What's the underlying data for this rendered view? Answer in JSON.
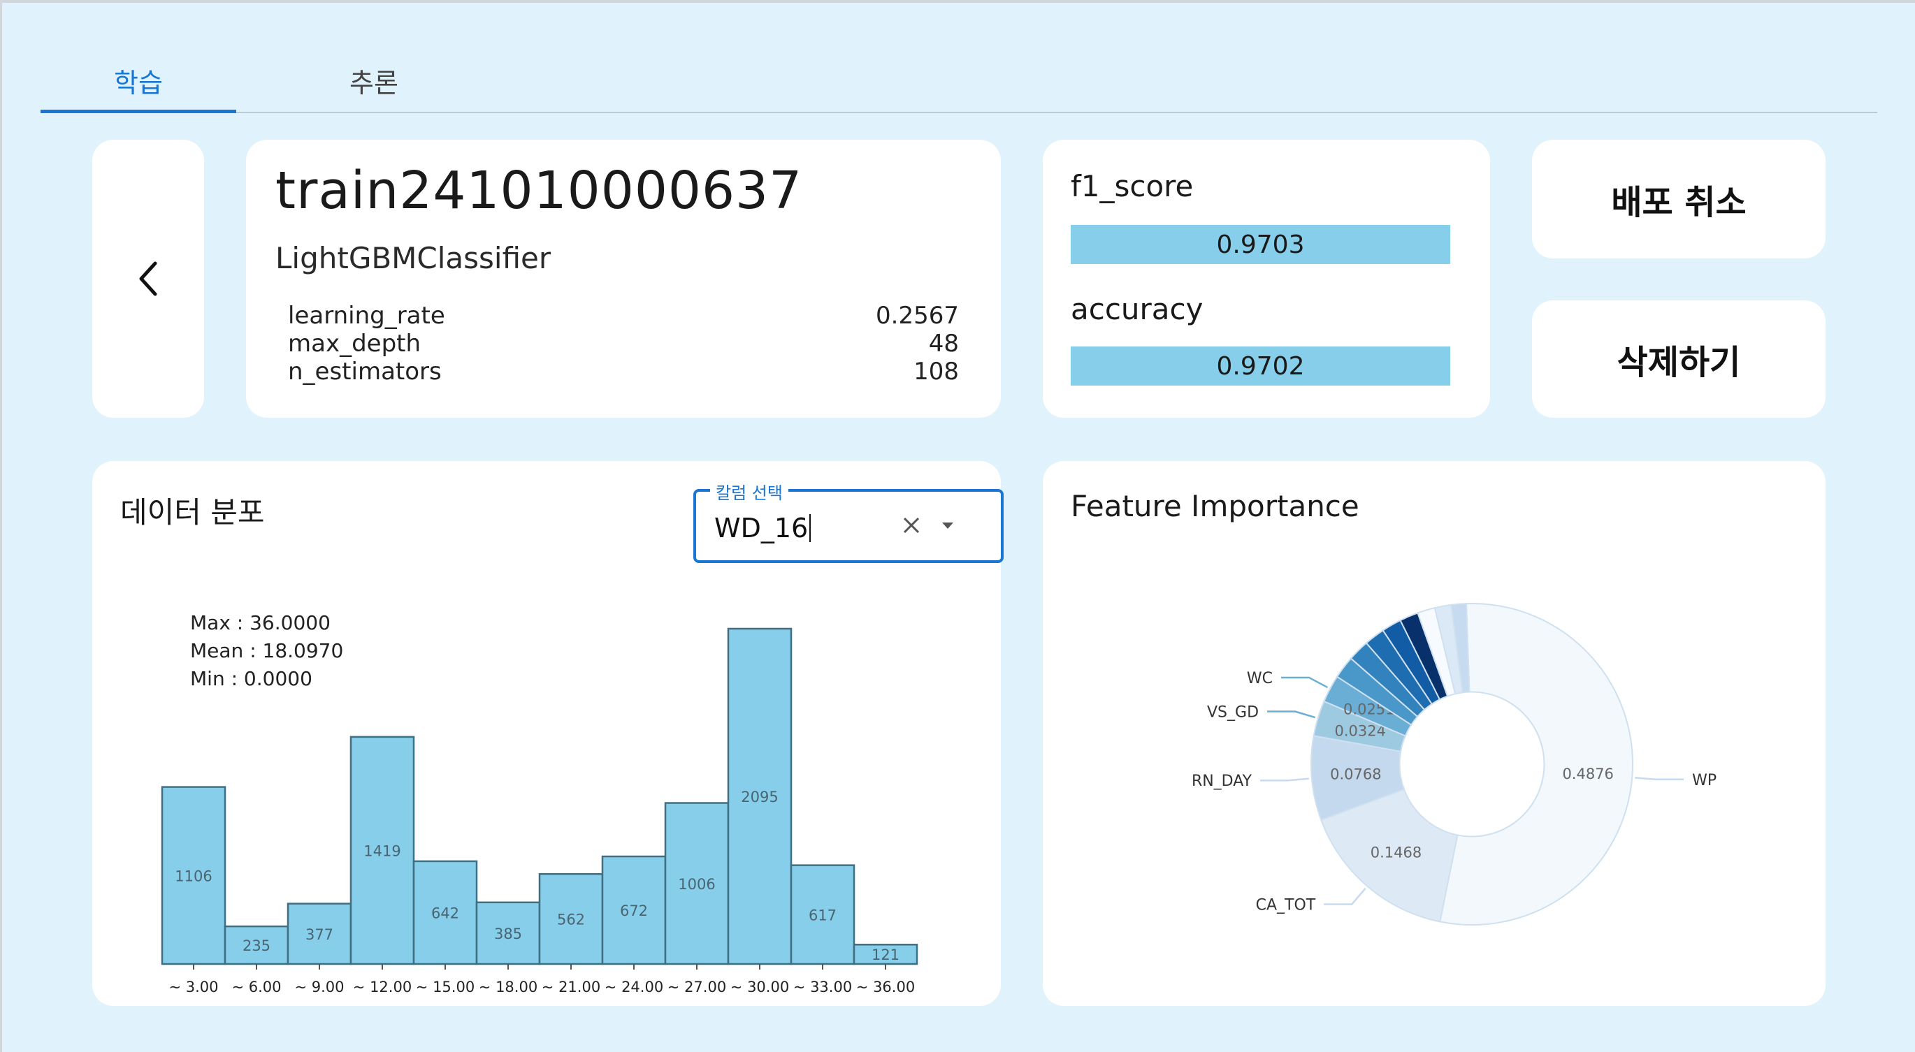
{
  "tabs": [
    {
      "label": "학습",
      "active": true
    },
    {
      "label": "추론",
      "active": false
    }
  ],
  "model": {
    "name": "train241010000637",
    "algorithm": "LightGBMClassifier",
    "params": [
      {
        "name": "learning_rate",
        "value": "0.2567"
      },
      {
        "name": "max_depth",
        "value": "48"
      },
      {
        "name": "n_estimators",
        "value": "108"
      }
    ]
  },
  "metrics": [
    {
      "label": "f1_score",
      "value": "0.9703"
    },
    {
      "label": "accuracy",
      "value": "0.9702"
    }
  ],
  "actions": {
    "cancel_deploy": "배포 취소",
    "delete": "삭제하기"
  },
  "distribution": {
    "title": "데이터 분포",
    "select_label": "칼럼 선택",
    "select_value": "WD_16",
    "stats": {
      "max": "Max : 36.0000",
      "mean": "Mean : 18.0970",
      "min": "Min : 0.0000"
    }
  },
  "chart_data": [
    {
      "type": "bar",
      "categories": [
        "~ 3.00",
        "~ 6.00",
        "~ 9.00",
        "~ 12.00",
        "~ 15.00",
        "~ 18.00",
        "~ 21.00",
        "~ 24.00",
        "~ 27.00",
        "~ 30.00",
        "~ 33.00",
        "~ 36.00"
      ],
      "values": [
        1106,
        235,
        377,
        1419,
        642,
        385,
        562,
        672,
        1006,
        2095,
        617,
        121
      ],
      "bar_color": "#87ceeb",
      "bar_stroke": "#3f6f82",
      "ylim": [
        0,
        2095
      ]
    },
    {
      "type": "pie",
      "title": "Feature Importance",
      "slices": [
        {
          "label": "WP",
          "value": 0.4876,
          "value_label": "0.4876",
          "color": "#f3f8fd"
        },
        {
          "label": "CA_TOT",
          "value": 0.1468,
          "value_label": "0.1468",
          "color": "#dde9f5"
        },
        {
          "label": "RN_DAY",
          "value": 0.0768,
          "value_label": "0.0768",
          "color": "#c4d9ee"
        },
        {
          "label": "VS_GD",
          "value": 0.0324,
          "value_label": "0.0324",
          "color": "#9ecae1"
        },
        {
          "label": "WC",
          "value": 0.0251,
          "value_label": "0.0251",
          "color": "#6aaed6"
        },
        {
          "label": "",
          "value": 0.0206,
          "value_label": "",
          "color": "#4a98c9"
        },
        {
          "label": "",
          "value": 0.0196,
          "value_label": "",
          "color": "#3182bd"
        },
        {
          "label": "",
          "value": 0.0188,
          "value_label": "",
          "color": "#1f6db1"
        },
        {
          "label": "",
          "value": 0.018,
          "value_label": "",
          "color": "#115ca5"
        },
        {
          "label": "",
          "value": 0.017,
          "value_label": "",
          "color": "#08306b"
        },
        {
          "label": "",
          "value": 0.016,
          "value_label": "",
          "color": "#f7fbff"
        },
        {
          "label": "",
          "value": 0.015,
          "value_label": "",
          "color": "#dbe9f6"
        },
        {
          "label": "",
          "value": 0.0136,
          "value_label": "",
          "color": "#c6dbef"
        }
      ],
      "hole": 0.45
    }
  ]
}
